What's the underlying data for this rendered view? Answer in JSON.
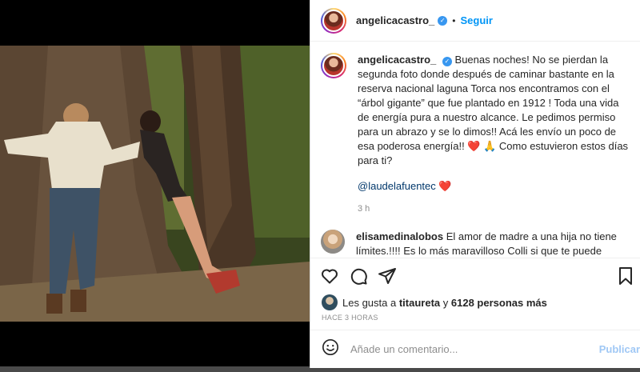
{
  "post": {
    "username": "angelicacastro_",
    "separator": "•",
    "follow_label": "Seguir",
    "caption": "Buenas noches! No se pierdan la segunda foto donde después de caminar bastante en la reserva nacional laguna Torca nos encontramos con el “árbol gigante” que fue plantado en 1912 ! Toda una vida de energía pura a nuestro alcance. Le pedimos permiso para un abrazo y se lo dimos!! Acá les envío un poco de esa poderosa energía!! ❤️ 🙏 Como estuvieron estos días para ti?",
    "mention": "@laudelafuentec",
    "mention_suffix": "❤️",
    "caption_time": "3 h"
  },
  "comment": {
    "username": "elisamedinalobos",
    "text": "El amor de madre a una hija no tiene límites.!!!! Es lo más maravilloso Colli si que te puede pasar, yo también tengo a mi horda de e 18 años. Esforzada , trabajadora , linda por dentro y por fuera , estudiosa."
  },
  "likes": {
    "prefix": "Les gusta a",
    "user": "titaureta",
    "conjunction": "y",
    "others": "6128 personas más"
  },
  "posted_ago": "HACE 3 HORAS",
  "add_comment": {
    "placeholder": "Añade un comentario...",
    "post_label": "Publicar"
  },
  "icons": [
    "verified-icon",
    "like-icon",
    "comment-icon",
    "share-icon",
    "save-icon",
    "emoji-icon"
  ],
  "colors": {
    "link": "#0095f6",
    "mention": "#00376b",
    "heart": "#ed4956",
    "verified": "#3897f0"
  }
}
